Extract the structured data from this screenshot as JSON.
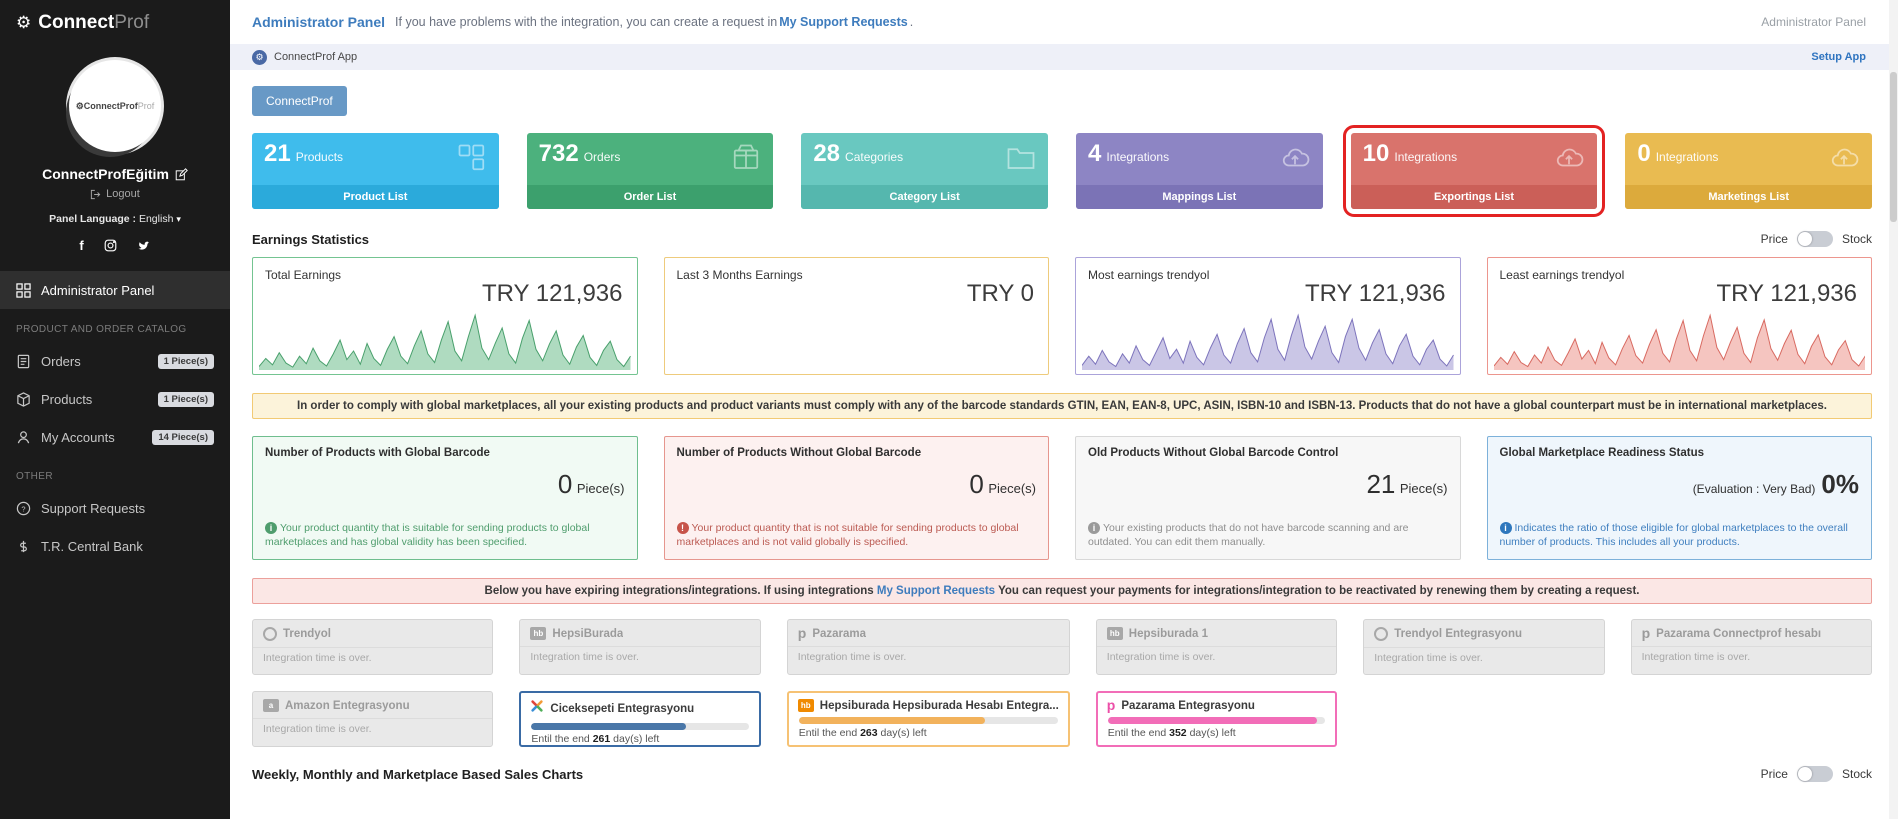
{
  "sidebar": {
    "brand_bold": "Connect",
    "brand_light": "Prof",
    "avatar_text": "ConnectProf",
    "profile_name": "ConnectProfEğitim",
    "logout": "Logout",
    "language_label": "Panel Language :",
    "language_value": "English",
    "nav_admin": "Administrator Panel",
    "section_catalog": "PRODUCT AND ORDER CATALOG",
    "nav_orders": "Orders",
    "orders_badge": "1 Piece(s)",
    "nav_products": "Products",
    "products_badge": "1 Piece(s)",
    "nav_accounts": "My Accounts",
    "accounts_badge": "14 Piece(s)",
    "section_other": "OTHER",
    "nav_support": "Support Requests",
    "nav_bank": "T.R. Central Bank"
  },
  "topbar": {
    "title": "Administrator Panel",
    "message": "If you have problems with the integration, you can create a request in",
    "link": "My Support Requests",
    "period": ".",
    "right": "Administrator Panel"
  },
  "appbar": {
    "app_name": "ConnectProf App",
    "setup": "Setup App"
  },
  "tab": {
    "label": "ConnectProf"
  },
  "stats": [
    {
      "value": "21",
      "label": "Products",
      "footer": "Product List",
      "bg": "#3fbcec",
      "footer_bg": "#2baadb"
    },
    {
      "value": "732",
      "label": "Orders",
      "footer": "Order List",
      "bg": "#4cb17d",
      "footer_bg": "#3ca06d"
    },
    {
      "value": "28",
      "label": "Categories",
      "footer": "Category List",
      "bg": "#69c8c0",
      "footer_bg": "#55b7ae"
    },
    {
      "value": "4",
      "label": "Integrations",
      "footer": "Mappings List",
      "bg": "#8d85c4",
      "footer_bg": "#7b73b6"
    },
    {
      "value": "10",
      "label": "Integrations",
      "footer": "Exportings List",
      "bg": "#d9736c",
      "footer_bg": "#cb5f58",
      "highlight": "#e32222"
    },
    {
      "value": "0",
      "label": "Integrations",
      "footer": "Marketings List",
      "bg": "#e9bb51",
      "footer_bg": "#dcaa3c"
    }
  ],
  "earnings": {
    "heading": "Earnings Statistics",
    "price": "Price",
    "stock": "Stock",
    "cards": [
      {
        "title": "Total Earnings",
        "value": "TRY 121,936",
        "border": "#74c491",
        "stroke": "#49a06c",
        "fill": "rgba(109,190,140,0.55)",
        "spark": [
          6,
          20,
          9,
          30,
          12,
          5,
          24,
          11,
          38,
          16,
          7,
          28,
          52,
          18,
          33,
          10,
          46,
          20,
          8,
          36,
          58,
          24,
          11,
          42,
          68,
          28,
          13,
          52,
          84,
          33,
          16,
          58,
          95,
          38,
          18,
          47,
          73,
          28,
          12,
          55,
          86,
          36,
          16,
          45,
          68,
          26,
          10,
          40,
          60,
          22,
          8,
          34,
          50,
          18,
          6,
          24
        ]
      },
      {
        "title": "Last 3 Months Earnings",
        "value": "TRY 0",
        "border": "#eecb7c"
      },
      {
        "title": "Most earnings trendyol",
        "value": "TRY 121,936",
        "border": "#aba3da",
        "stroke": "#7d74bc",
        "fill": "rgba(150,142,205,0.5)",
        "spark": [
          8,
          24,
          10,
          34,
          14,
          6,
          28,
          12,
          42,
          18,
          8,
          32,
          56,
          20,
          36,
          12,
          50,
          22,
          9,
          38,
          62,
          26,
          12,
          46,
          72,
          30,
          14,
          56,
          88,
          36,
          17,
          60,
          95,
          40,
          19,
          50,
          76,
          30,
          13,
          58,
          88,
          38,
          17,
          47,
          70,
          28,
          11,
          42,
          62,
          24,
          9,
          36,
          52,
          19,
          7,
          26
        ]
      },
      {
        "title": "Least earnings trendyol",
        "value": "TRY 121,936",
        "border": "#ec968e",
        "stroke": "#d86a61",
        "fill": "rgba(235,140,130,0.5)",
        "spark": [
          7,
          22,
          10,
          32,
          13,
          6,
          26,
          12,
          40,
          17,
          8,
          30,
          54,
          19,
          34,
          11,
          48,
          21,
          9,
          37,
          60,
          25,
          12,
          44,
          70,
          29,
          14,
          54,
          86,
          34,
          16,
          59,
          95,
          39,
          18,
          48,
          74,
          29,
          13,
          56,
          87,
          37,
          17,
          46,
          69,
          27,
          11,
          41,
          61,
          23,
          9,
          35,
          51,
          18,
          7,
          25
        ]
      }
    ]
  },
  "barcode_notice": "In order to comply with global marketplaces, all your existing products and product variants must comply with any of the barcode standards GTIN, EAN, EAN-8, UPC, ASIN, ISBN-10 and ISBN-13. Products that do not have a global counterpart must be in international marketplaces.",
  "barcode_cards": [
    {
      "title": "Number of Products with Global Barcode",
      "value": "0",
      "unit": "Piece(s)",
      "desc": "Your product quantity that is suitable for sending products to global marketplaces and has global validity has been specified.",
      "bg": "#f1faf4",
      "border": "#6fbe8e",
      "text": "#4f9d6d",
      "icon_bg": "#4f9d6d",
      "icon_glyph": "i"
    },
    {
      "title": "Number of Products Without Global Barcode",
      "value": "0",
      "unit": "Piece(s)",
      "desc": "Your product quantity that is not suitable for sending products to global marketplaces and is not valid globally is specified.",
      "bg": "#fdf1f0",
      "border": "#e6968e",
      "text": "#bb5a52",
      "icon_bg": "#c7544a",
      "icon_glyph": "!"
    },
    {
      "title": "Old Products Without Global Barcode Control",
      "value": "21",
      "unit": "Piece(s)",
      "desc": "Your existing products that do not have barcode scanning and are outdated. You can edit them manually.",
      "bg": "#f7f7f7",
      "border": "#d8d8d8",
      "text": "#8f8f8f",
      "icon_bg": "#9a9a9a",
      "icon_glyph": "i"
    },
    {
      "title": "Global Marketplace Readiness Status",
      "prefix": "(Evaluation : Very Bad)",
      "value": "0%",
      "unit": "",
      "desc": "Indicates the ratio of those eligible for global marketplaces to the overall number of products. This includes all your products.",
      "bg": "#eff6fc",
      "border": "#7db1da",
      "text": "#3f7fbf",
      "icon_bg": "#2e77bd",
      "icon_glyph": "i"
    }
  ],
  "expiring_notice": {
    "before": "Below you have expiring integrations/integrations. If using integrations",
    "link": "My Support Requests",
    "after": "You can request your payments for integrations/integration to be reactivated by renewing them by creating a request."
  },
  "progress_text": {
    "before": "Entil the end",
    "after": "day(s) left"
  },
  "integrations": [
    {
      "name": "Trendyol",
      "status": "Integration time is over."
    },
    {
      "name": "HepsiBurada",
      "status": "Integration time is over.",
      "icon_text": "hb"
    },
    {
      "name": "Pazarama",
      "status": "Integration time is over.",
      "icon_text": "p"
    },
    {
      "name": "Hepsiburada 1",
      "status": "Integration time is over.",
      "icon_text": "hb"
    },
    {
      "name": "Trendyol Entegrasyonu",
      "status": "Integration time is over."
    },
    {
      "name": "Pazarama Connectprof hesabı",
      "status": "Integration time is over.",
      "icon_text": "p"
    },
    {
      "name": "Amazon Entegrasyonu",
      "status": "Integration time is over.",
      "icon_text": "a"
    },
    {
      "name": "Ciceksepeti Entegrasyonu",
      "border": "#3a6ba5",
      "bar": "#4a77a8",
      "progress": "71%",
      "days": "261"
    },
    {
      "name": "Hepsiburada Hepsiburada Hesabı Entegra...",
      "border": "#f6c274",
      "bar": "#f2b25c",
      "progress": "72%",
      "days": "263",
      "icon_text": "hb"
    },
    {
      "name": "Pazarama Entegrasyonu",
      "border": "#f26db8",
      "bar": "#f26db8",
      "progress": "96%",
      "days": "352",
      "icon_text": "p"
    }
  ],
  "bottom": {
    "heading": "Weekly, Monthly and Marketplace Based Sales Charts",
    "price": "Price",
    "stock": "Stock"
  }
}
